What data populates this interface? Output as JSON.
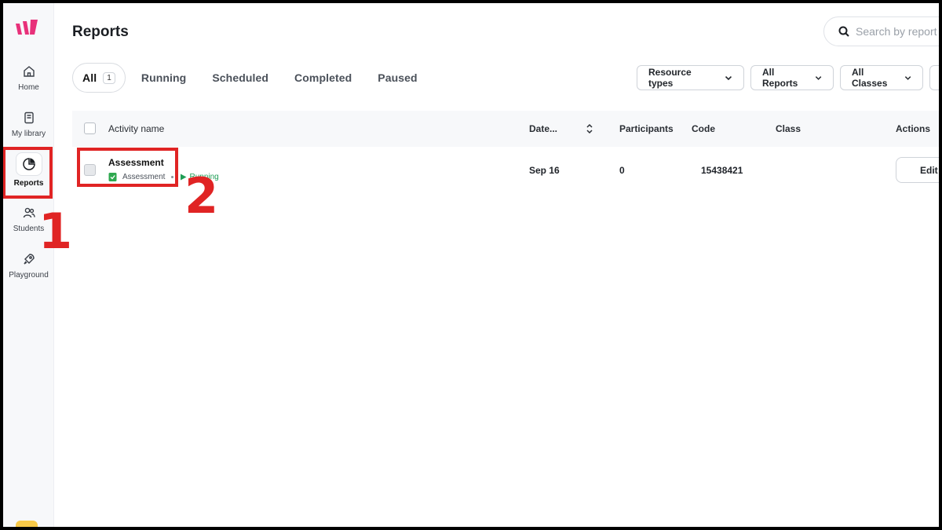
{
  "sidebar": {
    "items": [
      {
        "label": "Home",
        "icon": "home-icon"
      },
      {
        "label": "My library",
        "icon": "book-icon"
      },
      {
        "label": "Reports",
        "icon": "pie-chart-icon",
        "active": true
      },
      {
        "label": "Students",
        "icon": "users-icon"
      },
      {
        "label": "Playground",
        "icon": "rocket-icon"
      }
    ]
  },
  "header": {
    "title": "Reports",
    "search_placeholder": "Search by report"
  },
  "tabs": [
    {
      "label": "All",
      "count": "1",
      "active": true
    },
    {
      "label": "Running"
    },
    {
      "label": "Scheduled"
    },
    {
      "label": "Completed"
    },
    {
      "label": "Paused"
    }
  ],
  "filters": {
    "resource_types": "Resource types",
    "all_reports": "All Reports",
    "all_classes": "All Classes"
  },
  "table": {
    "columns": {
      "activity_name": "Activity name",
      "date": "Date...",
      "participants": "Participants",
      "code": "Code",
      "class": "Class",
      "actions": "Actions"
    },
    "rows": [
      {
        "name": "Assessment",
        "type": "Assessment",
        "status": "Running",
        "date": "Sep 16",
        "participants": "0",
        "code": "15438421",
        "class": "",
        "action": "Edit"
      }
    ]
  },
  "annotations": {
    "step1": "1",
    "step2": "2",
    "color": "#e02424"
  },
  "colors": {
    "brand": "#e8317a",
    "running": "#1f9d55"
  }
}
